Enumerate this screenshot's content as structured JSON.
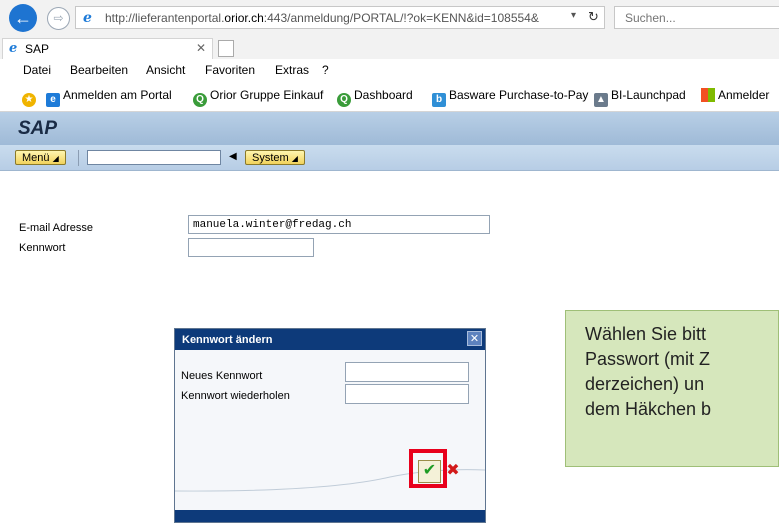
{
  "browser": {
    "url_prefix": "http://lieferantenportal.",
    "url_domain": "orior.ch",
    "url_suffix": ":443/anmeldung/PORTAL/!?ok=KENN&id=108554&",
    "search_placeholder": "Suchen...",
    "tab_title": "SAP",
    "menu": [
      "Datei",
      "Bearbeiten",
      "Ansicht",
      "Favoriten",
      "Extras",
      "?"
    ],
    "favorites": [
      "Anmelden am Portal",
      "Orior Gruppe Einkauf",
      "Dashboard",
      "Basware Purchase-to-Pay",
      "BI-Launchpad",
      "Anmelder"
    ]
  },
  "sap": {
    "title": "SAP",
    "menu_button": "Menü",
    "system_button": "System",
    "login": {
      "email_label": "E-mail Adresse",
      "email_value": "manuela.winter@fredag.ch",
      "password_label": "Kennwort",
      "password_value": ""
    },
    "dialog": {
      "title": "Kennwort ändern",
      "new_label": "Neues Kennwort",
      "repeat_label": "Kennwort wiederholen",
      "ok_icon": "checkmark-icon",
      "cancel_icon": "x-icon"
    }
  },
  "callout": {
    "lines": [
      "Wählen Sie bitt",
      "Passwort (mit Z",
      "derzeichen) un",
      "dem Häkchen b"
    ]
  },
  "colors": {
    "sap_dialog_title": "#0d3a7a",
    "highlight_frame": "#e8001c",
    "callout_bg": "#d6e7bc"
  }
}
